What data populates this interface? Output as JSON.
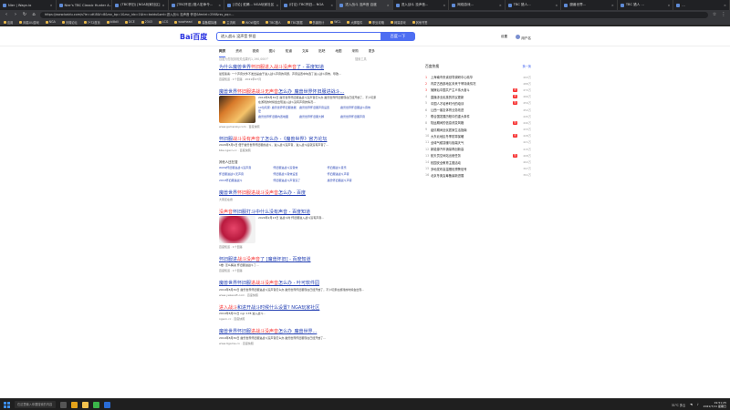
{
  "browser": {
    "tabs": [
      {
        "label": "Nier | Wagn.io",
        "active": false
      },
      {
        "label": "Nier's TBC Classic Hunter A...",
        "active": false
      },
      {
        "label": "(TBC怀旧) [NGA玩家社区]",
        "active": false
      },
      {
        "label": "[TBC怀旧] 猎人宏命令...",
        "active": false
      },
      {
        "label": "[讨论] 蛇蝎... NGA玩家社区",
        "active": false
      },
      {
        "label": "(讨论) TBC怀旧... NGA",
        "active": false
      },
      {
        "label": "进入战斗 没声音 百度",
        "active": true
      },
      {
        "label": "进入战斗 没声音...",
        "active": false
      },
      {
        "label": "网络游戏...",
        "active": false
      },
      {
        "label": "TBC 猎人...",
        "active": false
      },
      {
        "label": "魔兽世界...",
        "active": false
      },
      {
        "label": "TBC 猎人 ...",
        "active": false
      },
      {
        "label": "...",
        "active": false
      }
    ],
    "url": "https://www.baidu.com/s?ie=utf-8&f=8&rsv_bp=1&rsv_idx=1&tn=baidu&wd=进入战斗 没声音 怀旧&fenlei=256&rsv_pq=...",
    "bookmarks": [
      "应用",
      "网易UU游戏",
      "NGA",
      "天梯论坛",
      "7*72首页",
      "bilibili",
      "DCE",
      "2343",
      "LCG",
      "wowhead",
      "装备模拟器",
      "主流网",
      "WOW插件",
      "TBC猎人",
      "TBC数据",
      "伤害统计",
      "WCL",
      "大脚插件",
      "职业攻略",
      "网易游戏",
      "其他书签"
    ]
  },
  "search": {
    "logo": "Bai百度",
    "query": "进入战斗 没声音 怀旧",
    "button": "百度一下",
    "header_right": [
      "设置",
      "用户名"
    ],
    "tabs": [
      "网页",
      "资讯",
      "视频",
      "图片",
      "知道",
      "文库",
      "贴吧",
      "地图",
      "采购",
      "更多"
    ],
    "meta": "百度为您找到相关结果约1,190,000个",
    "tools": "搜索工具"
  },
  "results": [
    {
      "title_a": "为什么魔兽世界",
      "title_em": "怀旧服进入战斗没声音",
      "title_b": "了 - 百度知道",
      "desc": "最佳答案: 一个声音文件不发出是由于进入战斗声音的问题，声音设置中勾选了进入战斗音效，导致...",
      "src": "百度知道 · 1个回答 · 2021年07月"
    },
    {
      "title_a": "魔兽世界",
      "title_em": "怀旧服进战斗无声音",
      "title_b": "怎么办_魔兽世界怀旧服进战斗...",
      "desc": "2019年8月30日 魔兽世界怀旧服进战斗没声音怎么办 魔兽世界怀旧服现在已经开放了，不少玩家在游戏的时候会出现进入战斗没有声音的情况...",
      "links": [
        "10位玩家: 魔兽世界怀旧服技能宏",
        "魔兽世界怀旧服声音设置",
        "魔兽世界怀旧服战斗音效",
        "魔兽世界怀旧服内置地图",
        "魔兽世界怀旧服大脚",
        "魔兽世界怀旧服声音"
      ],
      "src": "www.gamersky.com · 百度快照"
    },
    {
      "title_a": "怀旧服",
      "title_em": "战斗没有声音",
      "title_b": "了怎么办 -《魔兽世界》官方论坛",
      "desc": "2020年5月9日 便于魔兽世界怀旧服的战斗，进入战斗没声音，进入战斗后就没有声音了...",
      "src": "bbs.ngacn.cc · 百度快照"
    },
    {
      "title_a": "魔兽世界",
      "title_em": "怀旧服进战斗没声音",
      "title_b": "怎么办 - 百度",
      "desc": "",
      "src": "大家还在搜"
    },
    {
      "title_a": "",
      "title_em": "没声音",
      "title_b": "怀旧服打斗中什么没有声音 - 百度知道",
      "desc": "2020年2月13日 进战斗时 怀旧服进入战斗没有声音...",
      "src": "百度知道 · 1个回答"
    },
    {
      "title_a": "怀旧服进",
      "title_em": "战斗没声音",
      "title_b": "了 [魔兽怀旧] - 百度知道",
      "desc": "1楼: 怎么解决 怀旧服进战斗了...",
      "src": "百度知道 · 1个回答"
    },
    {
      "title_a": "魔兽世界怀旧服",
      "title_em": "进战斗没声音",
      "title_b": "怎么办 - 叶可软件园",
      "desc": "2019年8月30日 魔兽世界怀旧服进战斗没声音怎么办 魔兽世界怀旧服现在已经开放了，不少玩家在游戏的时候会出现...",
      "src": "www.yekesoft.com · 百度快照"
    },
    {
      "title_a": "",
      "title_em": "进入战斗",
      "title_b": "和进开战斗时候什么设置? NGA玩家社区",
      "desc": "2019年8月31日 ngc 178 进入战斗...",
      "src": "ngacn.cc · 百度快照"
    },
    {
      "title_a": "魔兽世界怀旧服",
      "title_em": "进战斗没声音",
      "title_b": "怎么办_魔兽世界...",
      "desc": "2019年8月30日 魔兽世界怀旧服进战斗没声音怎么办 魔兽世界怀旧服现在已经开放了...",
      "src": "www.9game.cn · 百度快照"
    }
  ],
  "also_search": {
    "label": "其他人还在搜",
    "items": [
      "WOW怀旧服进战斗没声音",
      "怀旧服进战斗没音效",
      "怀旧服战斗音乐",
      "怀旧服进战斗无声音",
      "怀旧服战斗音效设置",
      "怀旧服进战斗声音",
      "2019怀旧服进战斗",
      "怀旧服进战斗声音没了",
      "魔兽怀旧服战斗声音"
    ]
  },
  "hot": {
    "title": "百度热搜",
    "change": "换一换",
    "items": [
      {
        "n": "1",
        "text": "上海南市央省领导调研中心精华",
        "badge": "",
        "heat": "493万"
      },
      {
        "n": "2",
        "text": "内蒙古西部地区未来干旱持续情况",
        "badge": "",
        "heat": "488万"
      },
      {
        "n": "3",
        "text": "摊牌后中国共产主义伟大奋斗",
        "badge": "新",
        "heat": "472万"
      },
      {
        "n": "4",
        "text": "直播涉业民族的热议更新",
        "badge": "新",
        "heat": "466万"
      },
      {
        "n": "5",
        "text": "中国人才培养时代的培训",
        "badge": "热",
        "heat": "459万"
      },
      {
        "n": "6",
        "text": "让西一朋友体育业务改进",
        "badge": "",
        "heat": "452万"
      },
      {
        "n": "7",
        "text": "联合国发展历程中的重大事件",
        "badge": "",
        "heat": "445万"
      },
      {
        "n": "8",
        "text": "陆运期间的信息改变风格",
        "badge": "热",
        "heat": "440万"
      },
      {
        "n": "9",
        "text": "疫情期间全民居家生活指南",
        "badge": "",
        "heat": "433万"
      },
      {
        "n": "10",
        "text": "大东北地区冬季防寒保暖",
        "badge": "新",
        "heat": "428万"
      },
      {
        "n": "11",
        "text": "全球气候变暖与极端天气",
        "badge": "",
        "heat": "421万"
      },
      {
        "n": "12",
        "text": "新能源汽车销量再创新高",
        "badge": "",
        "heat": "415万"
      },
      {
        "n": "13",
        "text": "航天员空间站出舱任务",
        "badge": "热",
        "heat": "408万"
      },
      {
        "n": "14",
        "text": "校园安全教育主题活动",
        "badge": "",
        "heat": "402万"
      },
      {
        "n": "15",
        "text": "多地发布高温橙色预警信号",
        "badge": "",
        "heat": "397万"
      },
      {
        "n": "16",
        "text": "北京冬奥会筹备最新进展",
        "badge": "",
        "heat": "391万"
      }
    ]
  },
  "taskbar": {
    "search_placeholder": "在这里输入你要搜索的内容",
    "weather": "31°C 多云",
    "time": "19:51:25",
    "date": "2021/7/11 星期日"
  },
  "colors": {
    "baidu_blue": "#4e6ef2",
    "link": "#2440b3",
    "highlight": "#f73131"
  }
}
